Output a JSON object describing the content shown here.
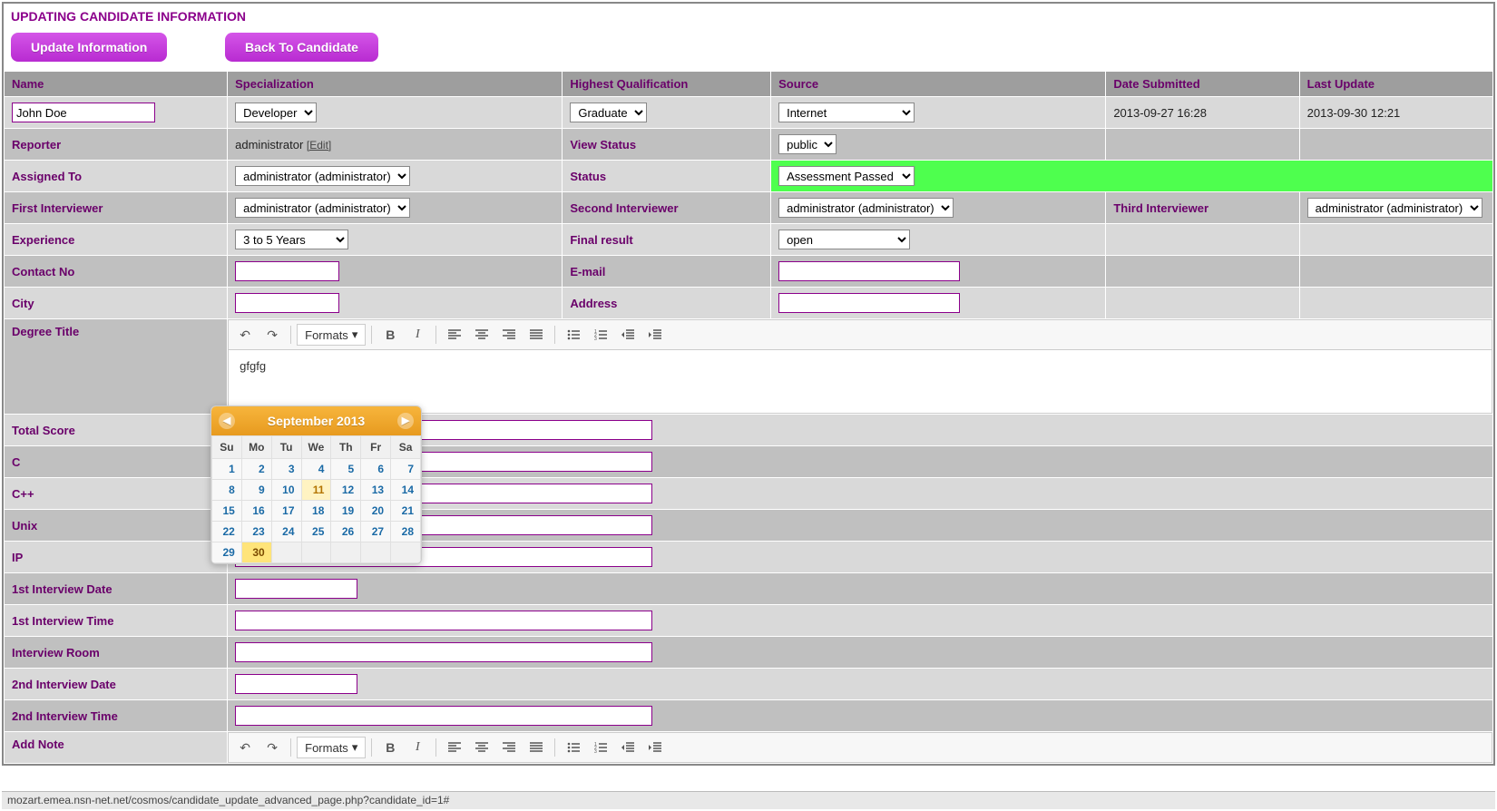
{
  "page": {
    "title": "UPDATING CANDIDATE INFORMATION"
  },
  "buttons": {
    "update": "Update Information",
    "back": "Back To Candidate"
  },
  "headers": {
    "name": "Name",
    "specialization": "Specialization",
    "highest_qual": "Highest Qualification",
    "source": "Source",
    "date_submitted": "Date Submitted",
    "last_update": "Last Update"
  },
  "labels": {
    "reporter": "Reporter",
    "view_status": "View Status",
    "assigned_to": "Assigned To",
    "status": "Status",
    "first_interviewer": "First Interviewer",
    "second_interviewer": "Second Interviewer",
    "third_interviewer": "Third Interviewer",
    "experience": "Experience",
    "final_result": "Final result",
    "contact_no": "Contact No",
    "email": "E-mail",
    "city": "City",
    "address": "Address",
    "degree_title": "Degree Title",
    "total_score": "Total Score",
    "c": "C",
    "cpp": "C++",
    "unix": "Unix",
    "ip": "IP",
    "int1_date": "1st Interview Date",
    "int1_time": "1st Interview Time",
    "int_room": "Interview Room",
    "int2_date": "2nd Interview Date",
    "int2_time": "2nd Interview Time",
    "add_note": "Add Note",
    "edit": "[Edit]"
  },
  "values": {
    "name": "John Doe",
    "specialization": "Developer",
    "highest_qual": "Graduate",
    "source": "Internet",
    "date_submitted": "2013-09-27 16:28",
    "last_update": "2013-09-30 12:21",
    "reporter": "administrator",
    "view_status": "public",
    "assigned_to": "administrator (administrator)",
    "status": "Assessment Passed",
    "first_interviewer": "administrator (administrator)",
    "second_interviewer": "administrator (administrator)",
    "third_interviewer": "administrator (administrator)",
    "experience": "3 to 5 Years",
    "final_result": "open",
    "contact_no": "",
    "email": "",
    "city": "",
    "address": "",
    "degree_title_content": "gfgfg",
    "total_score": "",
    "c": "",
    "cpp": "",
    "unix": "",
    "ip": "",
    "int1_date": "",
    "int1_time": "",
    "int_room": "",
    "int2_date": "",
    "int2_time": ""
  },
  "rt": {
    "formats": "Formats"
  },
  "calendar": {
    "title": "September 2013",
    "dow": [
      "Su",
      "Mo",
      "Tu",
      "We",
      "Th",
      "Fr",
      "Sa"
    ],
    "weeks": [
      [
        1,
        2,
        3,
        4,
        5,
        6,
        7
      ],
      [
        8,
        9,
        10,
        11,
        12,
        13,
        14
      ],
      [
        15,
        16,
        17,
        18,
        19,
        20,
        21
      ],
      [
        22,
        23,
        24,
        25,
        26,
        27,
        28
      ],
      [
        29,
        30,
        null,
        null,
        null,
        null,
        null
      ]
    ],
    "highlight": 11,
    "today": 30
  },
  "status_bar": "mozart.emea.nsn-net.net/cosmos/candidate_update_advanced_page.php?candidate_id=1#"
}
